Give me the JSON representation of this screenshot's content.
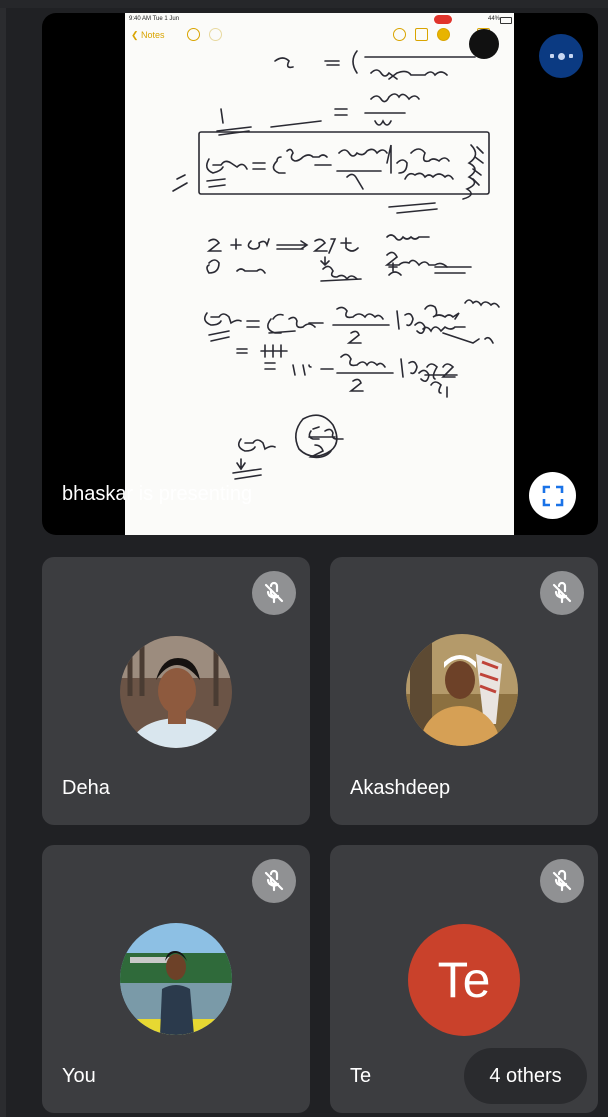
{
  "presentation": {
    "presenting_label": "bhaskar is presenting",
    "shared_screen": {
      "status_time": "9:40 AM  Tue 1 Jun",
      "status_battery": "44%",
      "notes_back_label": "Notes"
    }
  },
  "participants": [
    {
      "name": "Deha",
      "muted": true
    },
    {
      "name": "Akashdeep",
      "muted": true
    },
    {
      "name": "You",
      "muted": true
    },
    {
      "name": "Te",
      "initials": "Te",
      "muted": true
    }
  ],
  "others_label": "4 others",
  "colors": {
    "background": "#202124",
    "tile": "#3c3d40",
    "more_button": "#0b3a82",
    "initials_avatar": "#c9412b",
    "muted_badge": "#909193"
  },
  "icons": {
    "more": "more-options-icon",
    "fullscreen": "fullscreen-icon",
    "mute": "mic-off-icon"
  }
}
